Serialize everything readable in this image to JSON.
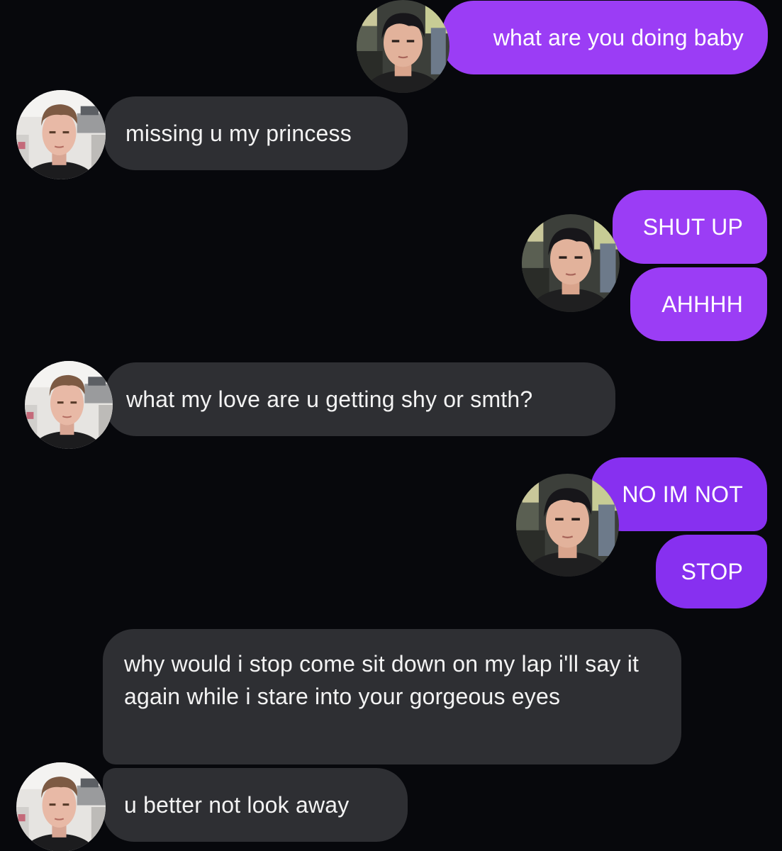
{
  "colors": {
    "background": "#07080c",
    "sent_bubble_primary": "#9b3df5",
    "sent_bubble_alt": "#8730f0",
    "received_bubble": "#2e2f33"
  },
  "avatars": {
    "sender": "avatar-dark-hair-man",
    "receiver": "avatar-blond-man"
  },
  "messages": [
    {
      "from": "me",
      "text": "what are you doing baby"
    },
    {
      "from": "them",
      "text": "missing u my princess"
    },
    {
      "from": "me",
      "text": "SHUT UP"
    },
    {
      "from": "me",
      "text": "AHHHH"
    },
    {
      "from": "them",
      "text": "what my love are u getting shy or smth?"
    },
    {
      "from": "me",
      "text": "NO IM NOT"
    },
    {
      "from": "me",
      "text": "STOP"
    },
    {
      "from": "them",
      "text": "why would i stop come sit down on my lap i'll say it again while i stare into your gorgeous eyes"
    },
    {
      "from": "them",
      "text": "u better not look away"
    }
  ]
}
